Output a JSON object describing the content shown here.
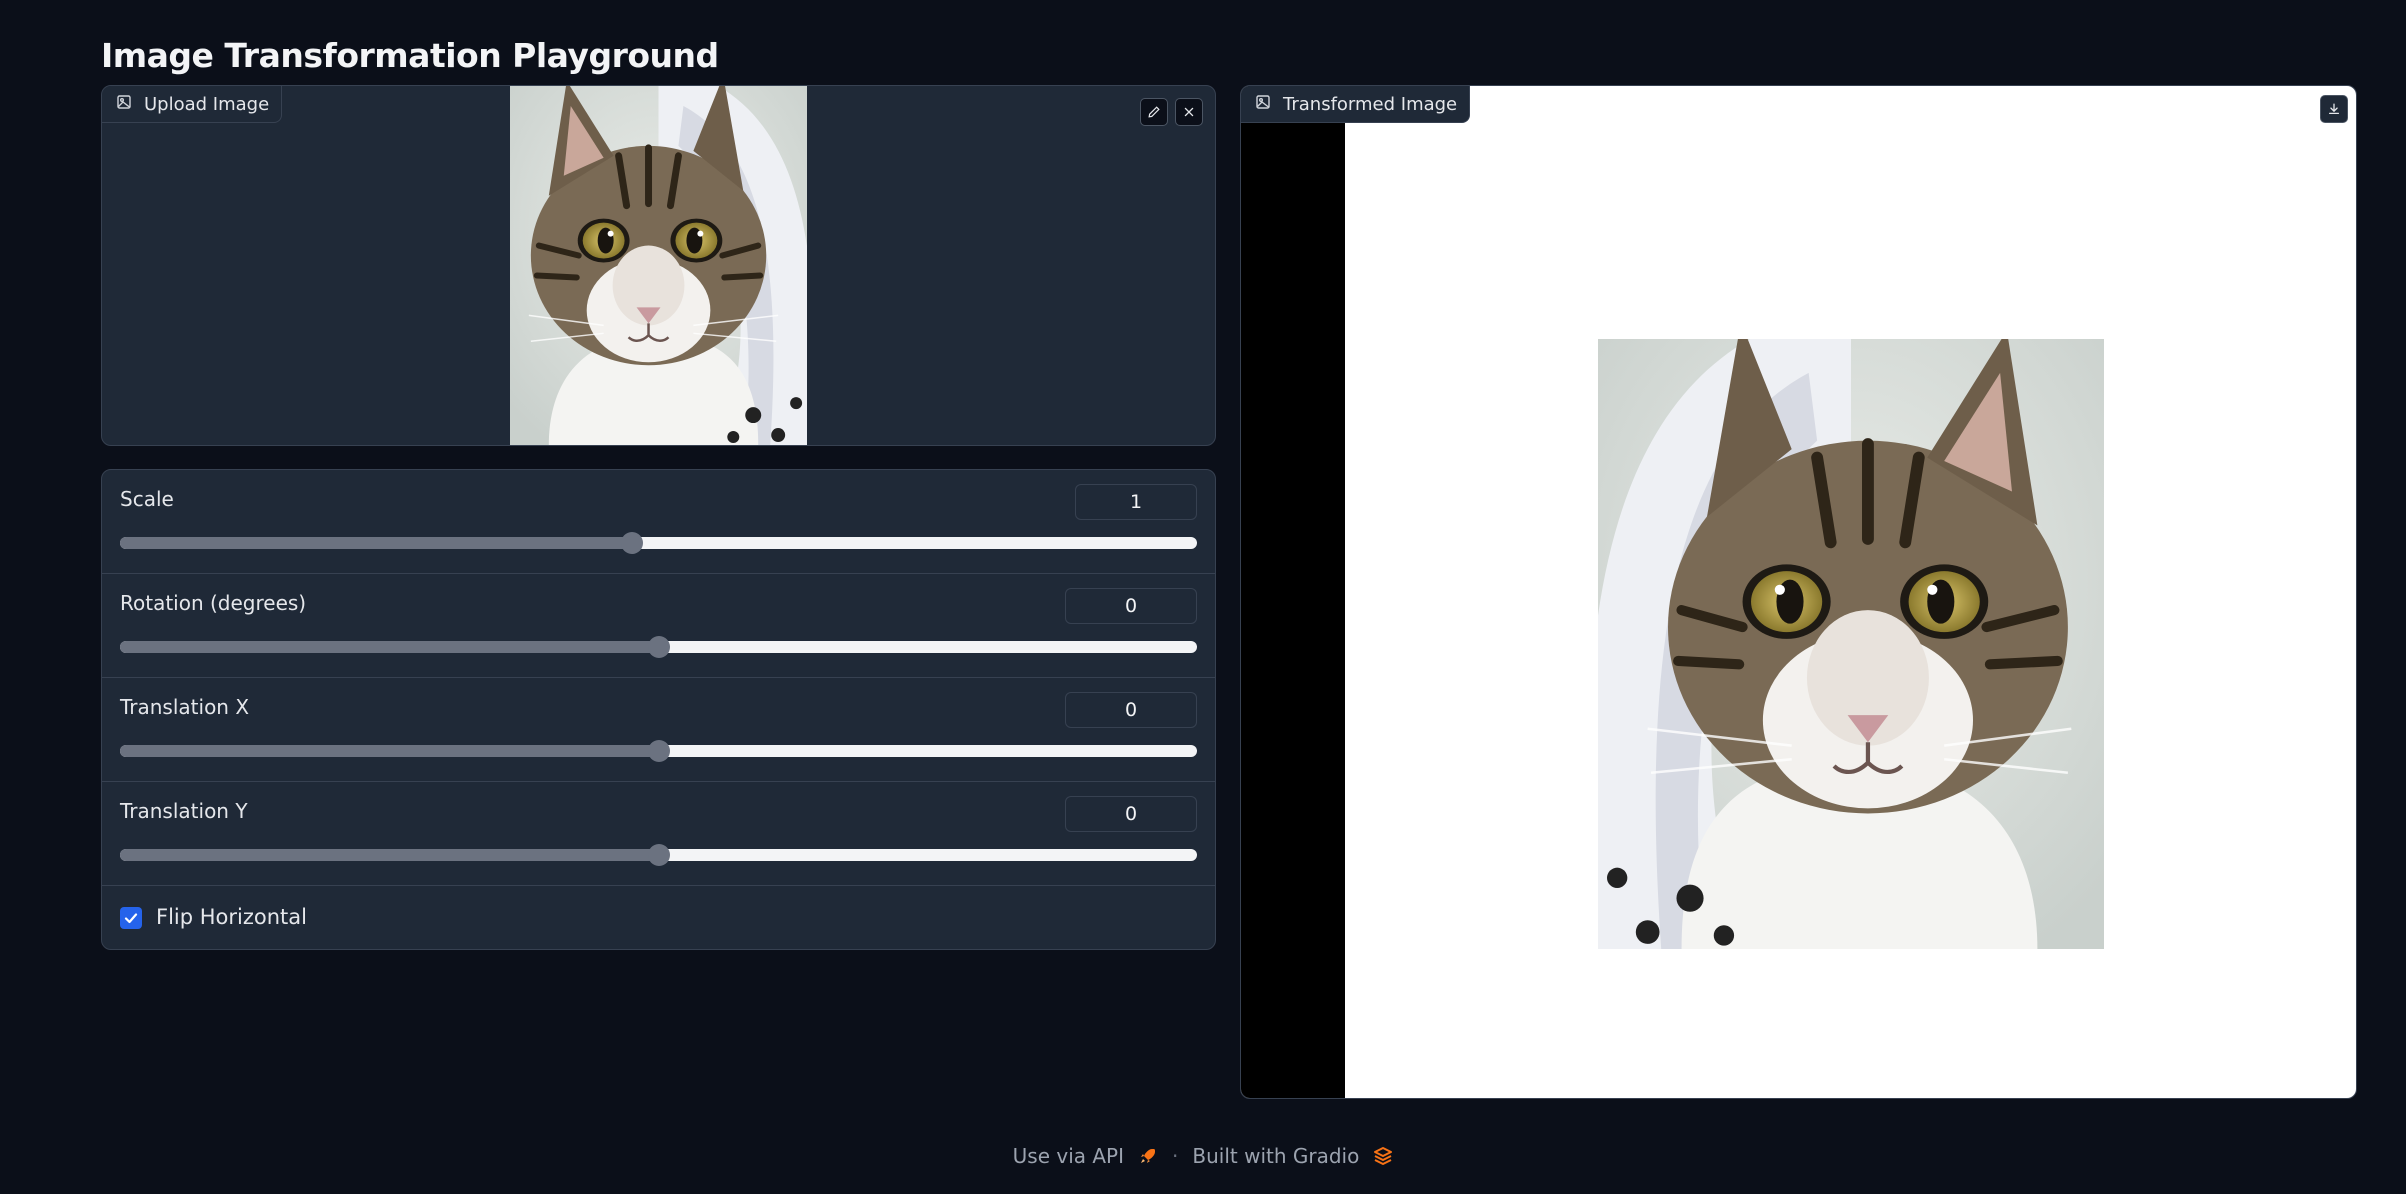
{
  "app": {
    "title": "Image Transformation Playground"
  },
  "upload": {
    "label": "Upload Image",
    "label_icon": "image-icon",
    "edit_icon": "pencil-icon",
    "clear_icon": "close-icon"
  },
  "controls": {
    "sliders": [
      {
        "label": "Scale",
        "value": "1",
        "fraction": 0.475
      },
      {
        "label": "Rotation (degrees)",
        "value": "0",
        "fraction": 0.5
      },
      {
        "label": "Translation X",
        "value": "0",
        "fraction": 0.5
      },
      {
        "label": "Translation Y",
        "value": "0",
        "fraction": 0.5
      }
    ],
    "flip": {
      "label": "Flip Horizontal",
      "checked": true
    }
  },
  "output": {
    "label": "Transformed Image",
    "label_icon": "image-icon",
    "download_icon": "download-icon"
  },
  "footer": {
    "api_label": "Use via API",
    "api_icon": "rocket-icon",
    "separator": "·",
    "built_label": "Built with Gradio",
    "gradio_icon": "gradio-logo-icon"
  },
  "colors": {
    "background": "#0b0f19",
    "panel": "#1f2937",
    "border": "#374151",
    "accent": "#2563eb",
    "footer_icon": "#f97316"
  }
}
